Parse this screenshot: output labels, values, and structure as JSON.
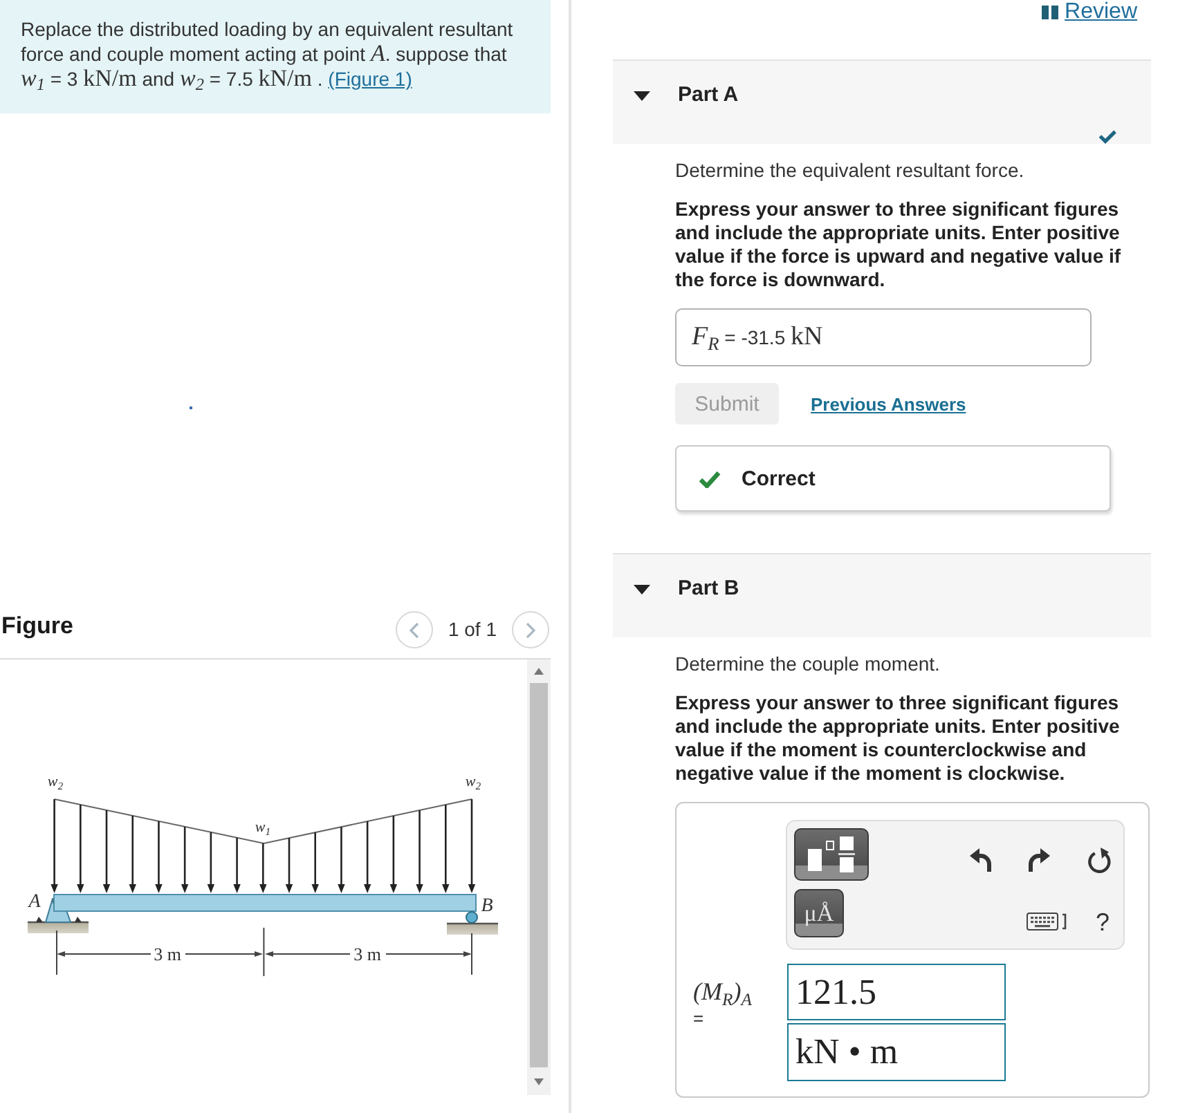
{
  "review_link": {
    "label": "Review"
  },
  "problem": {
    "segments": [
      {
        "kind": "text",
        "text": "Replace the distributed loading by an equivalent resultant force and couple moment acting at point "
      },
      {
        "kind": "math",
        "text": "A"
      },
      {
        "kind": "text",
        "text": ". suppose that "
      },
      {
        "kind": "math",
        "text": "w$_{1}$"
      },
      {
        "kind": "text",
        "text": " = 3 "
      },
      {
        "kind": "unit",
        "text": "kN/m"
      },
      {
        "kind": "text",
        "text": " and "
      },
      {
        "kind": "math",
        "text": "w$_{2}$"
      },
      {
        "kind": "text",
        "text": " = 7.5 "
      },
      {
        "kind": "unit",
        "text": "kN/m"
      },
      {
        "kind": "text",
        "text": " . "
      }
    ],
    "link": "(Figure 1)"
  },
  "figure": {
    "title": "Figure",
    "pager": "1 of 1",
    "load_labels": [
      "w$_{2}$",
      "w$_{1}$",
      "w$_{2}$"
    ],
    "point_labels": [
      "A",
      "B"
    ],
    "dimension_labels": [
      "3 m",
      "3 m"
    ]
  },
  "parts": [
    {
      "label": "Part A",
      "kind": "answered",
      "expanded": true,
      "completed": true,
      "prompt": "Determine the equivalent resultant force.",
      "instructions": "Express your answer to three significant figures and include the appropriate units. Enter positive value if the force is upward and negative value if the force is downward.",
      "answer": [
        {
          "kind": "math",
          "text": "F$_{R}$"
        },
        {
          "kind": "text",
          "text": " = -31.5 "
        },
        {
          "kind": "unit",
          "text": "kN"
        }
      ],
      "submit": {
        "label": "Submit",
        "disabled": true
      },
      "previous_answers": "Previous Answers",
      "feedback": {
        "correct": true,
        "text": "Correct"
      }
    },
    {
      "label": "Part B",
      "kind": "editor",
      "expanded": true,
      "completed": false,
      "prompt": "Determine the couple moment.",
      "instructions": "Express your answer to three significant figures and include the appropriate units. Enter positive value if the moment is counterclockwise and negative value if the moment is clockwise.",
      "toolbar": {
        "units_button": "μÅ",
        "help": "?"
      },
      "answer_label": [
        {
          "kind": "math",
          "text": "(M$_{R}$)$_{A}$"
        },
        {
          "kind": "text",
          "text": "="
        }
      ],
      "value": "121.5",
      "unit": "kN • m"
    }
  ]
}
